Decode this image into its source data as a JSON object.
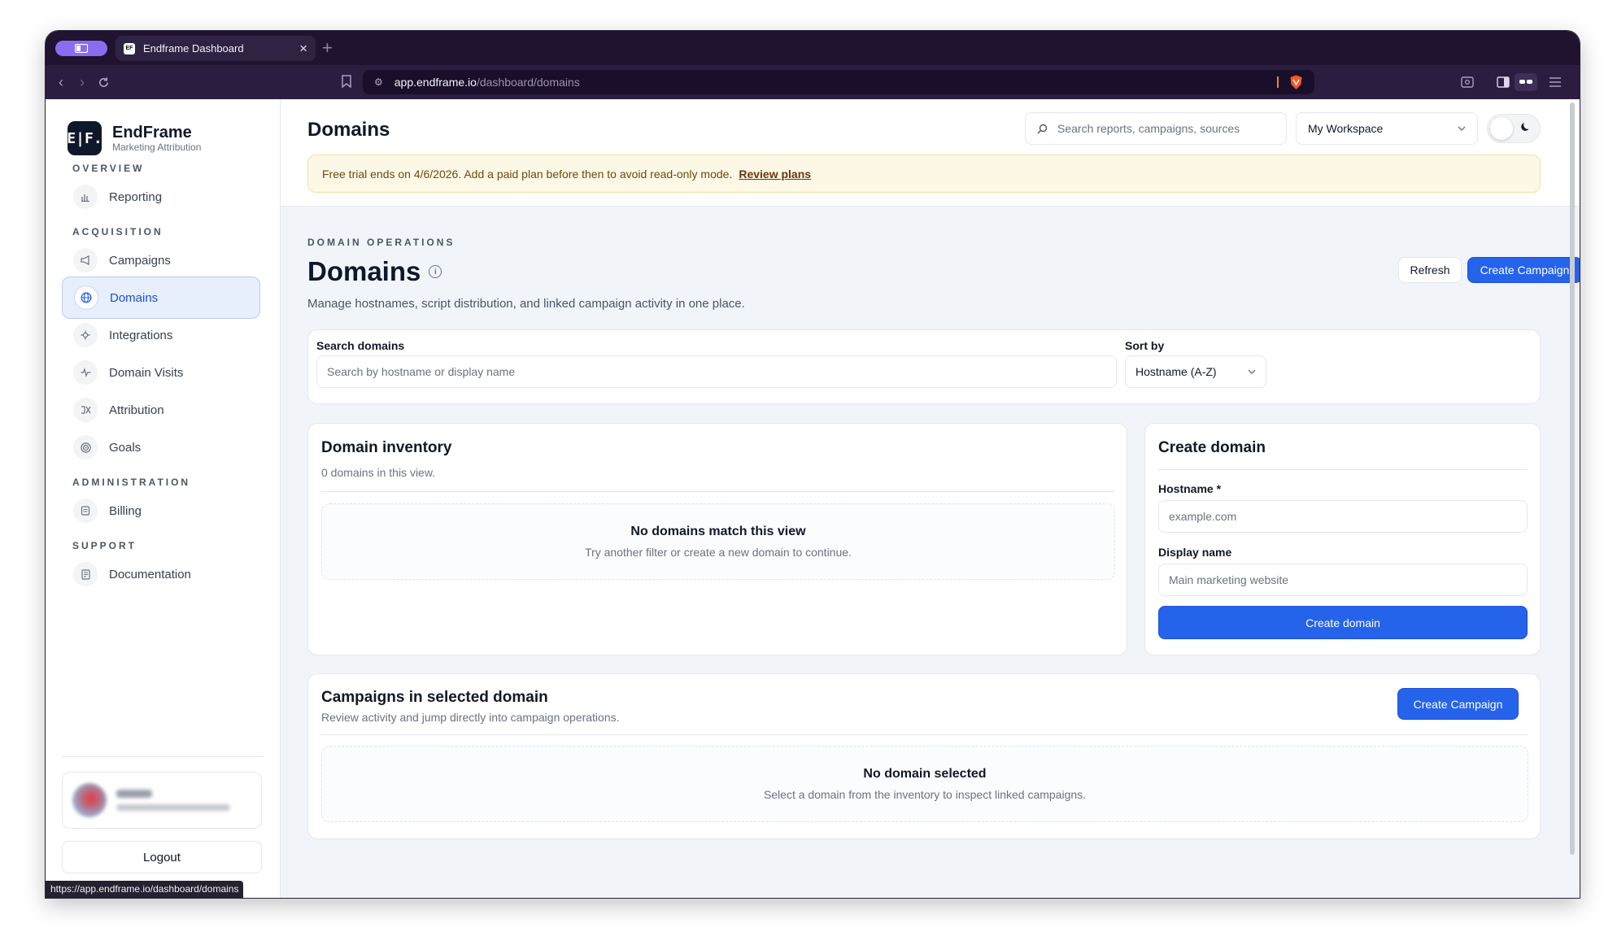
{
  "browser": {
    "tab_title": "Endframe Dashboard",
    "favicon_text": "EF",
    "url_host": "app.endframe.io",
    "url_path": "/dashboard/domains",
    "status_url": "https://app.endframe.io/dashboard/domains"
  },
  "brand": {
    "logo_text": "E|F.",
    "name": "EndFrame",
    "tagline": "Marketing Attribution"
  },
  "sidebar": {
    "sections": {
      "overview": "OVERVIEW",
      "acquisition": "ACQUISITION",
      "administration": "ADMINISTRATION",
      "support": "SUPPORT"
    },
    "items": {
      "reporting": "Reporting",
      "campaigns": "Campaigns",
      "domains": "Domains",
      "integrations": "Integrations",
      "domain_visits": "Domain Visits",
      "attribution": "Attribution",
      "goals": "Goals",
      "billing": "Billing",
      "documentation": "Documentation"
    },
    "active_item": "Domains",
    "logout_label": "Logout"
  },
  "header": {
    "title": "Domains",
    "search_placeholder": "Search reports, campaigns, sources",
    "workspace": "My Workspace"
  },
  "banner": {
    "text": "Free trial ends on 4/6/2026. Add a paid plan before then to avoid read-only mode.",
    "link": "Review plans"
  },
  "page": {
    "eyebrow": "DOMAIN OPERATIONS",
    "title": "Domains",
    "subtitle": "Manage hostnames, script distribution, and linked campaign activity in one place.",
    "refresh_label": "Refresh",
    "create_campaign_label": "Create Campaign"
  },
  "filters": {
    "search_label": "Search domains",
    "search_placeholder": "Search by hostname or display name",
    "sort_label": "Sort by",
    "sort_value": "Hostname (A-Z)"
  },
  "inventory": {
    "title": "Domain inventory",
    "count_text": "0 domains in this view.",
    "empty_title": "No domains match this view",
    "empty_sub": "Try another filter or create a new domain to continue."
  },
  "create_domain": {
    "title": "Create domain",
    "hostname_label": "Hostname *",
    "hostname_placeholder": "example.com",
    "display_label": "Display name",
    "display_placeholder": "Main marketing website",
    "submit_label": "Create domain"
  },
  "campaigns": {
    "title": "Campaigns in selected domain",
    "sub": "Review activity and jump directly into campaign operations.",
    "button_label": "Create Campaign",
    "empty_title": "No domain selected",
    "empty_sub": "Select a domain from the inventory to inspect linked campaigns."
  },
  "colors": {
    "primary": "#2563eb",
    "browser_frame": "#1f1330",
    "banner_bg": "#fdf8e6"
  }
}
